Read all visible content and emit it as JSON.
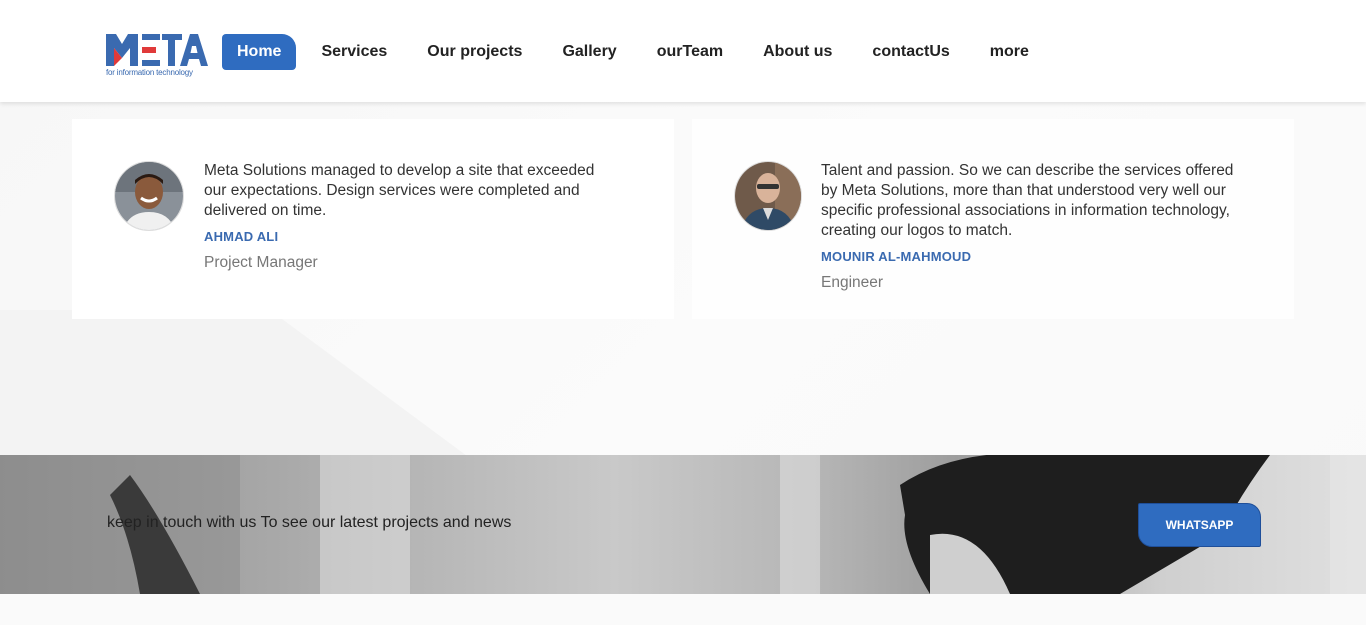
{
  "header": {
    "logo_text": "META",
    "logo_tagline": "for information technology",
    "nav": [
      {
        "label": "Home",
        "active": true
      },
      {
        "label": "Services",
        "active": false
      },
      {
        "label": "Our projects",
        "active": false
      },
      {
        "label": "Gallery",
        "active": false
      },
      {
        "label": "ourTeam",
        "active": false
      },
      {
        "label": "About us",
        "active": false
      },
      {
        "label": "contactUs",
        "active": false
      },
      {
        "label": "more",
        "active": false
      }
    ]
  },
  "testimonials": [
    {
      "quote_lines": [
        "Meta Solutions managed to develop a site that exceeded",
        "our expectations. Design services were completed and",
        "delivered on time."
      ],
      "name": "AHMAD ALI",
      "role": "Project Manager",
      "avatar_icon": "person-avatar"
    },
    {
      "quote_lines": [
        "Talent and passion. So we can describe the services offered",
        "by Meta Solutions, more than that understood very well our",
        "specific professional associations in information technology,",
        "creating our logos to match."
      ],
      "name": "MOUNIR AL-MAHMOUD",
      "role": "Engineer",
      "avatar_icon": "person-avatar"
    }
  ],
  "cta": {
    "text": "keep in touch with us To see our latest projects and news",
    "button_label": "WHATSAPP"
  },
  "colors": {
    "accent": "#2f6cc0",
    "author": "#3a6ab0",
    "logo_red": "#e03a3a"
  }
}
